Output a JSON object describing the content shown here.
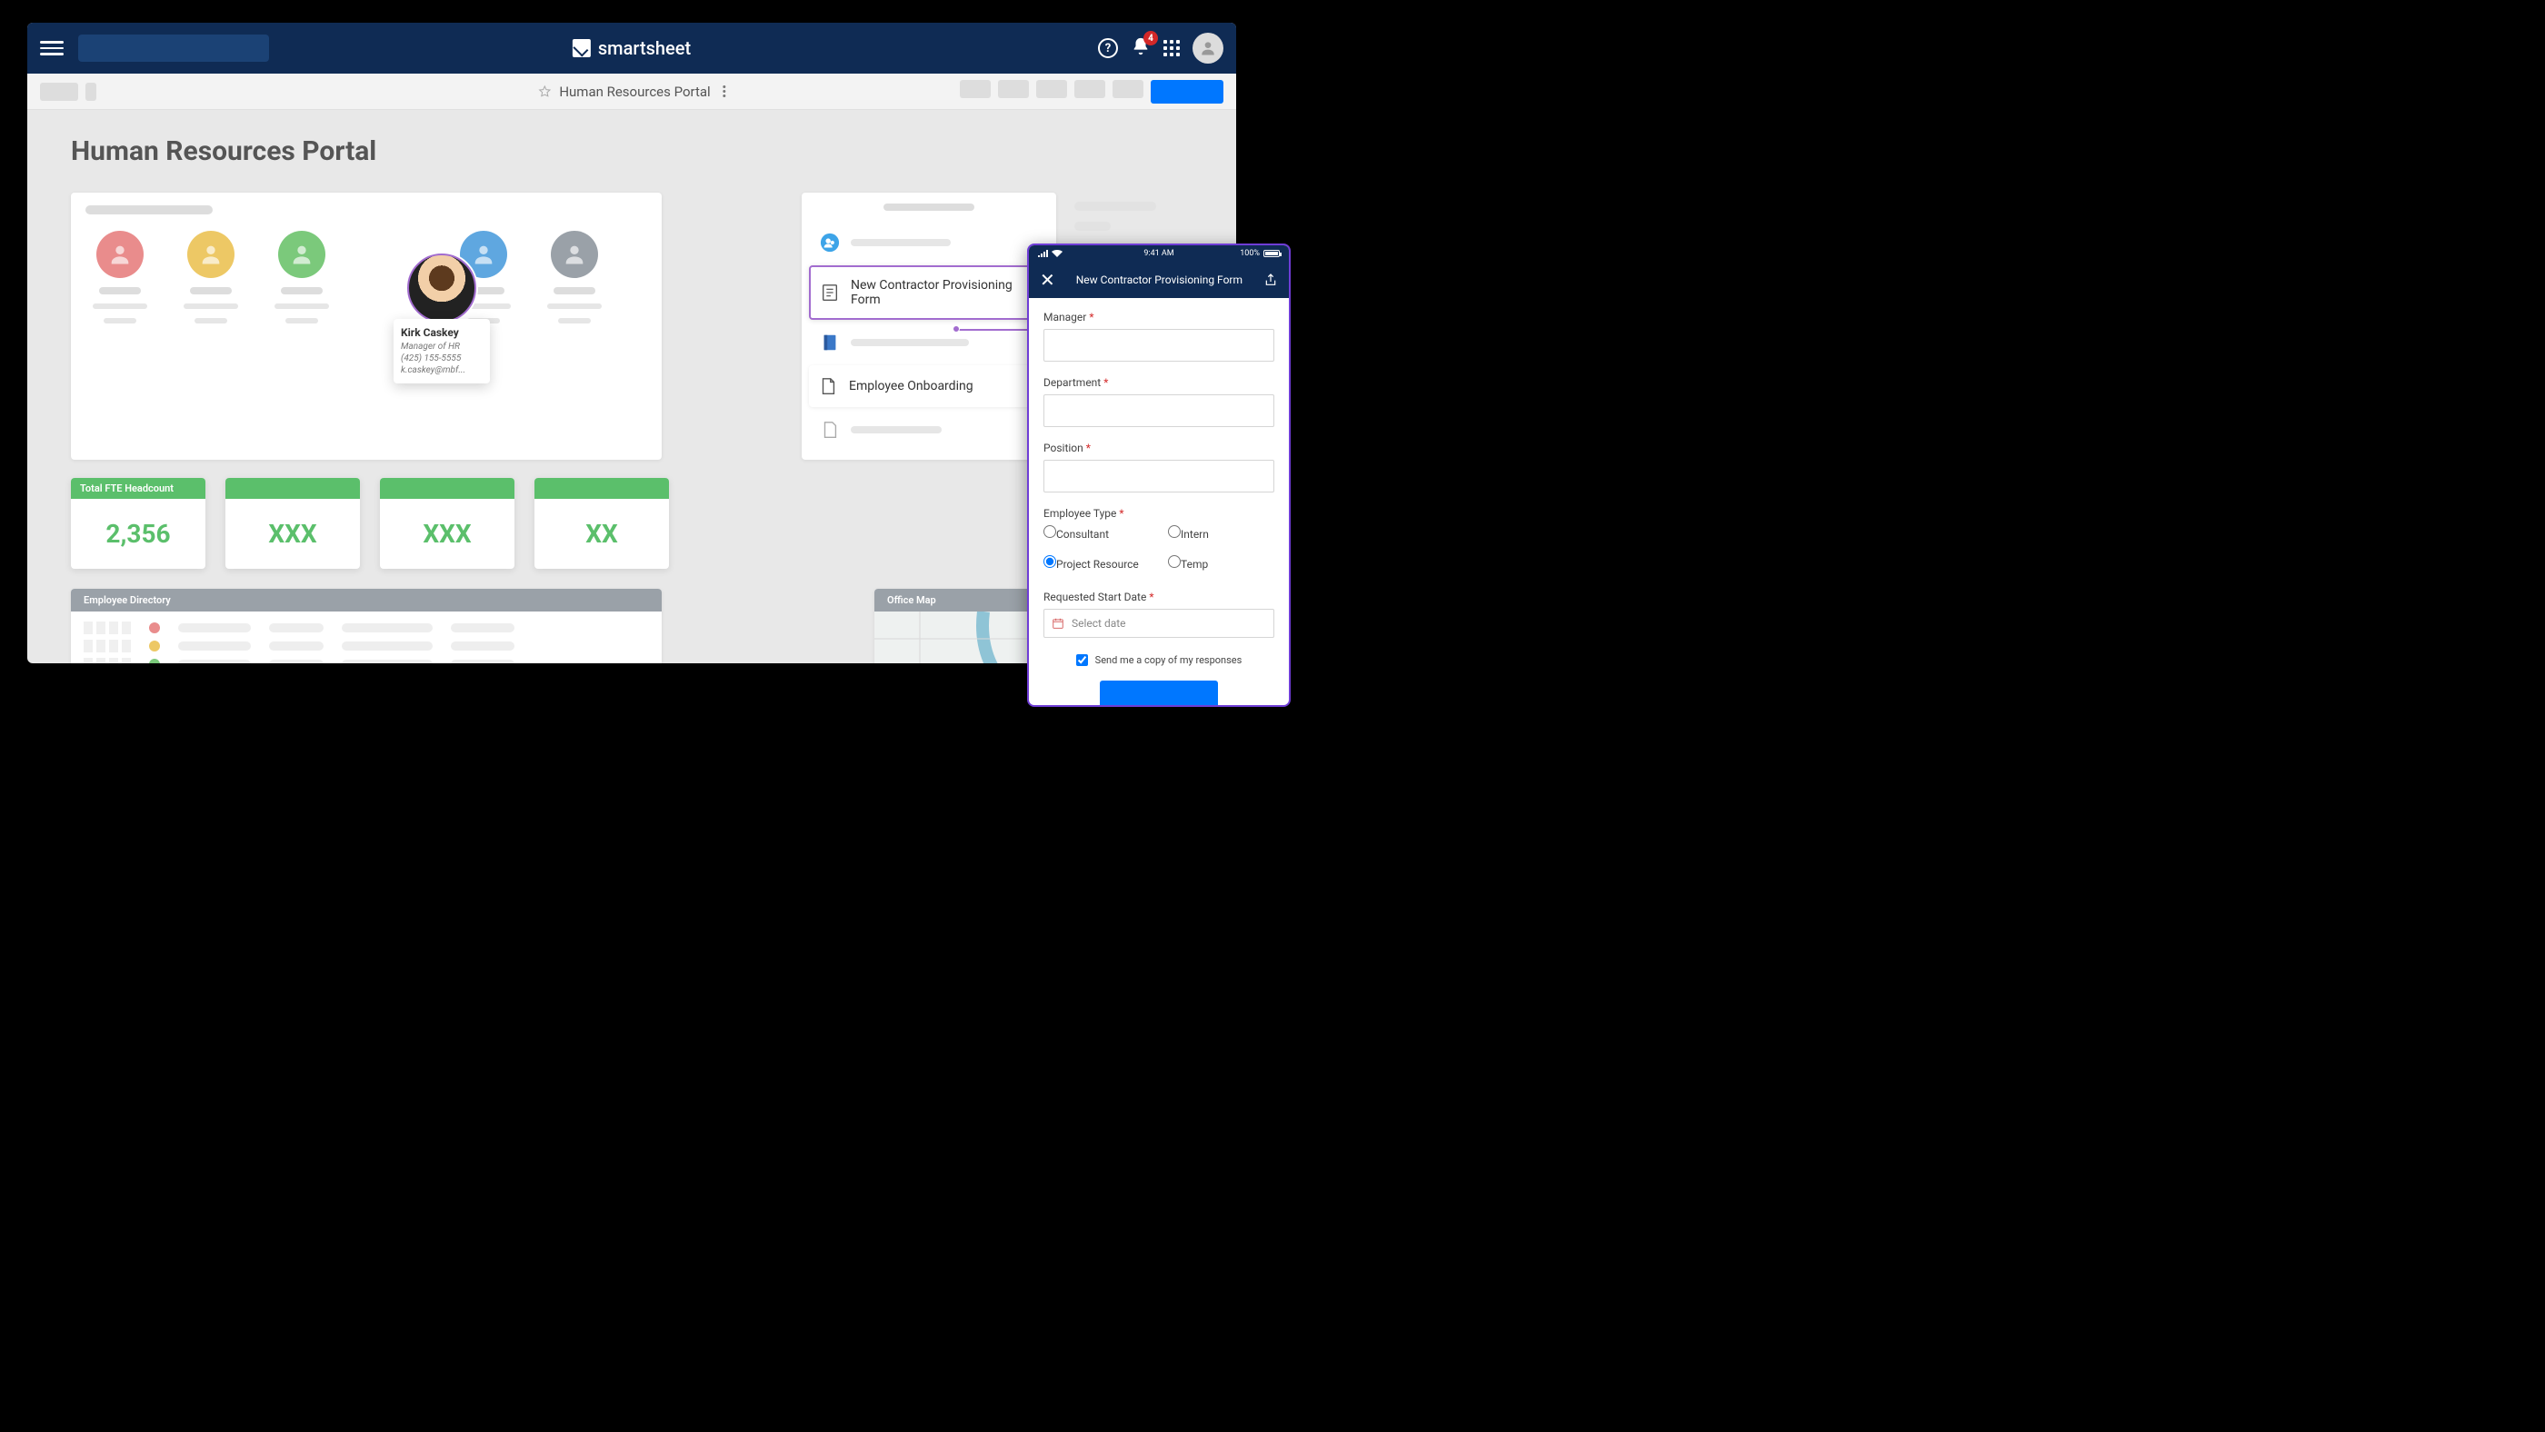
{
  "brand": "smartsheet",
  "notifications_count": "4",
  "toolbar": {
    "title": "Human Resources Portal"
  },
  "dashboard": {
    "title": "Human Resources Portal",
    "people_colors": [
      "#e98c8c",
      "#edc865",
      "#7bc97b",
      "#a26ccf",
      "#5fa7e0",
      "#9aa1a8"
    ],
    "metrics": [
      {
        "label": "Total FTE Headcount",
        "value": "2,356"
      },
      {
        "label": "",
        "value": "XXX"
      },
      {
        "label": "",
        "value": "XXX"
      },
      {
        "label": "",
        "value": "XX"
      }
    ],
    "right_items": {
      "form": "New Contractor Provisioning Form",
      "onboarding": "Employee Onboarding"
    },
    "employee_dir": {
      "title": "Employee Directory",
      "rows": [
        "#e98c8c",
        "#edc865",
        "#7bc97b",
        "#5fa7e0",
        "#c285d6",
        "#9aa1a8"
      ]
    },
    "office_map": {
      "title": "Office Map"
    }
  },
  "popover": {
    "name": "Kirk Caskey",
    "role": "Manager of HR",
    "phone": "(425) 155-5555",
    "email": "k.caskey@mbf..."
  },
  "phone": {
    "time": "9:41 AM",
    "battery": "100%",
    "title": "New Contractor Provisioning Form",
    "fields": {
      "manager": "Manager",
      "department": "Department",
      "position": "Position",
      "employee_type": "Employee Type",
      "start_date": "Requested Start Date",
      "date_placeholder": "Select date",
      "copy_label": "Send me a copy of my responses"
    },
    "employee_types": [
      "Consultant",
      "Intern",
      "Project Resource",
      "Temp"
    ],
    "selected_type": "Project Resource",
    "copy_checked": true
  }
}
